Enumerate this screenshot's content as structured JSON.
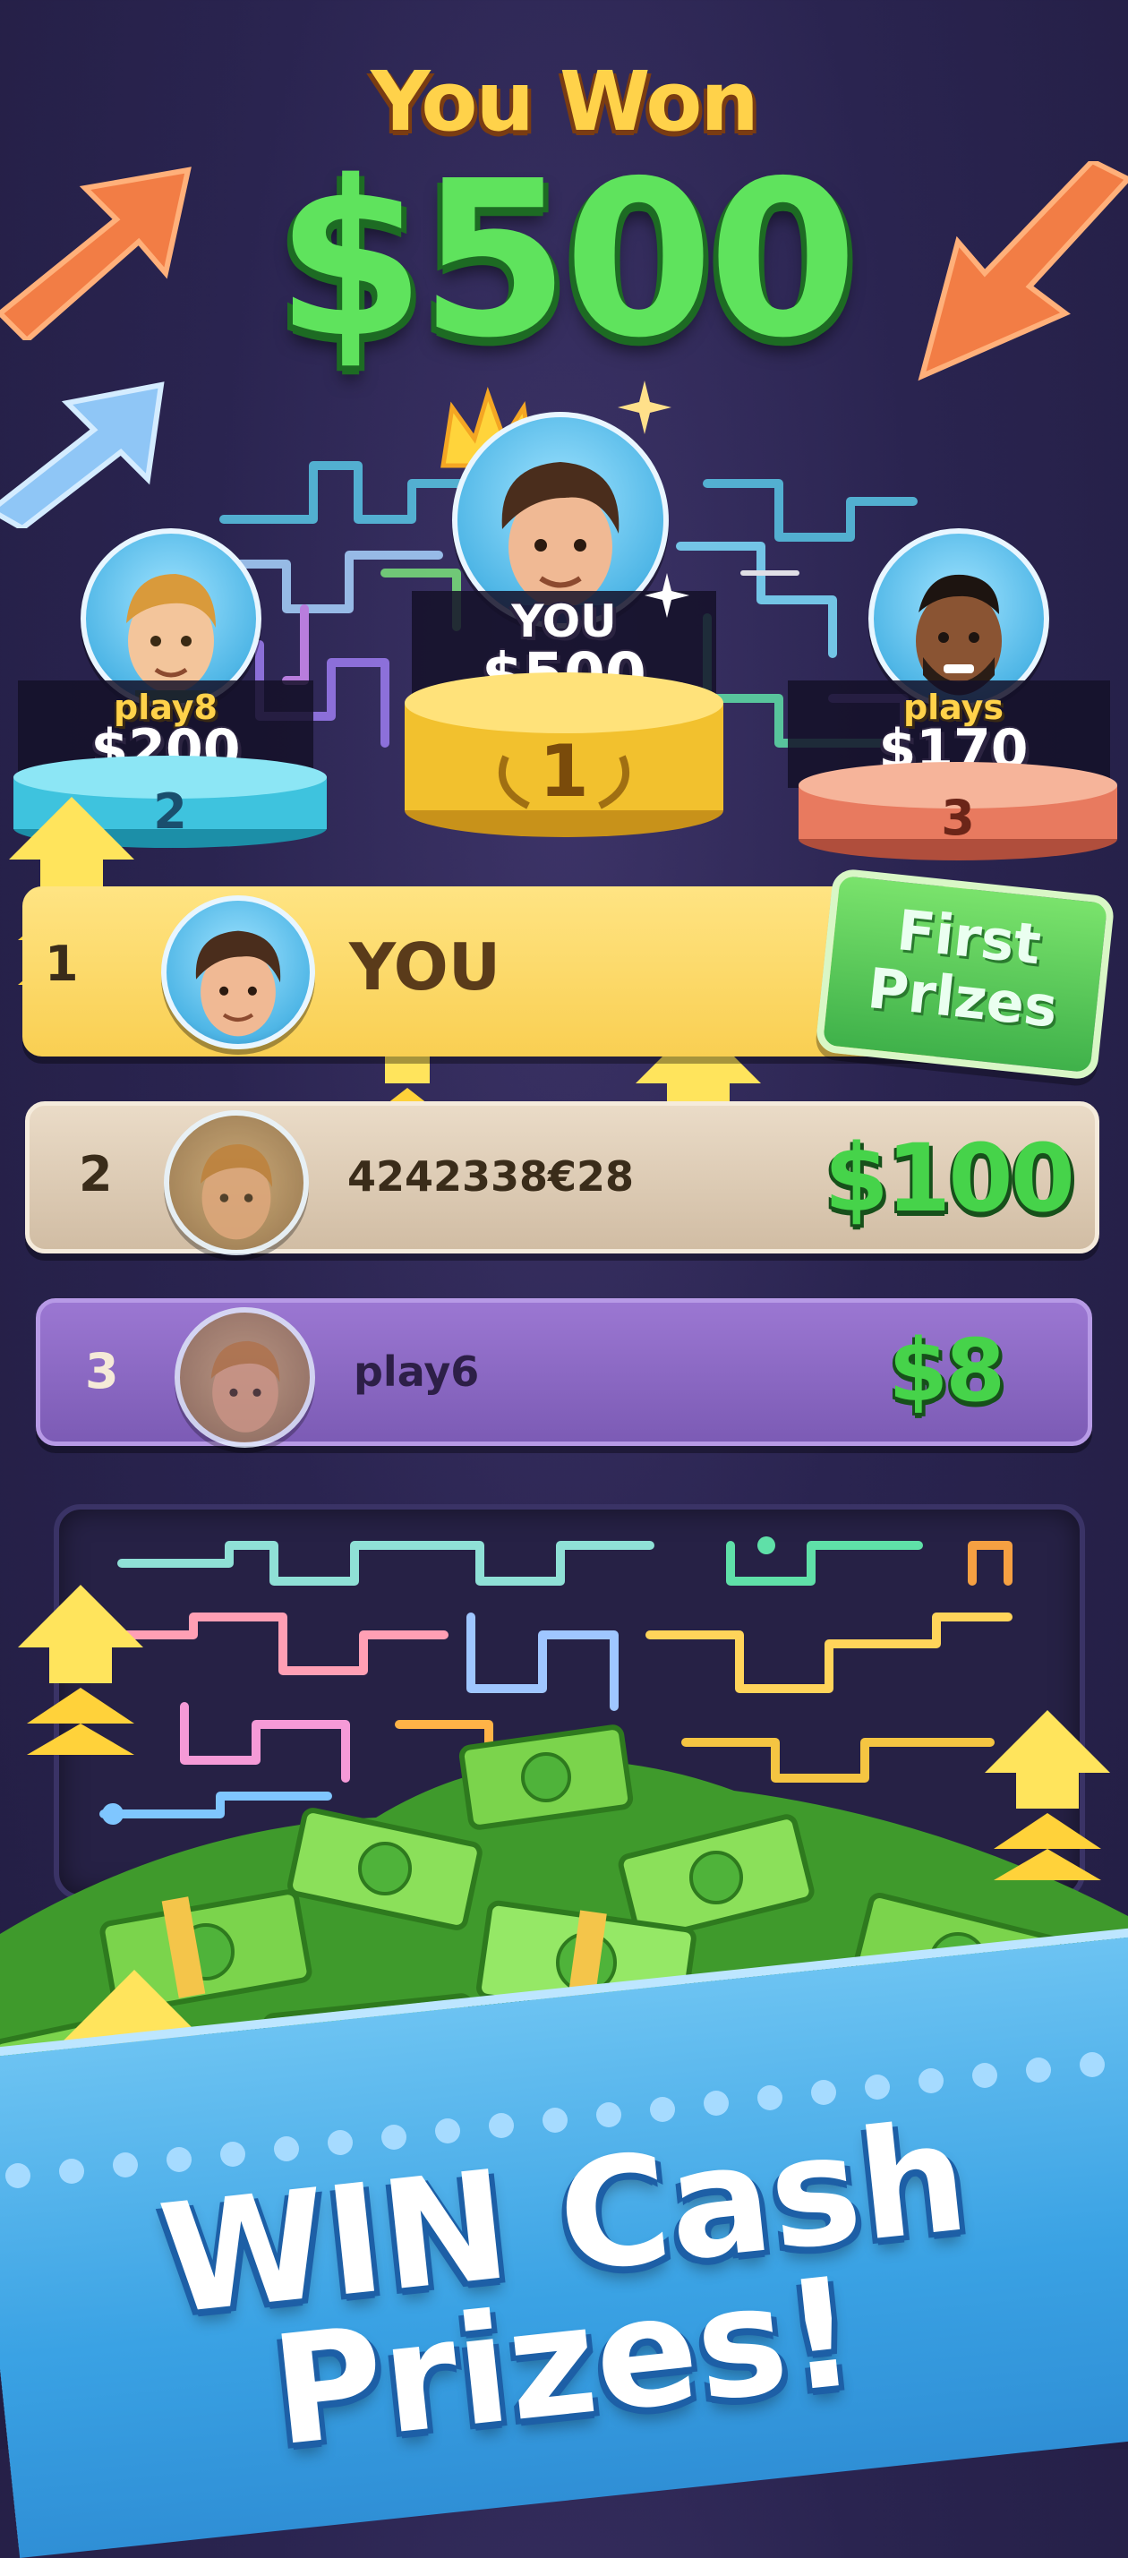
{
  "header": {
    "title_line1": "You Won",
    "title_amount": "$500"
  },
  "podium": {
    "first": {
      "name": "YOU",
      "amount": "$500",
      "place": "1"
    },
    "second": {
      "name": "play8",
      "amount": "$200",
      "place": "2"
    },
    "third": {
      "name": "plays",
      "amount": "$170",
      "place": "3"
    }
  },
  "leaderboard": [
    {
      "rank": "1",
      "name": "YOU",
      "badge_line1": "First",
      "badge_line2": "Prlzes"
    },
    {
      "rank": "2",
      "name": "4242338€28",
      "amount": "$100"
    },
    {
      "rank": "3",
      "name": "play6",
      "amount": "$8"
    }
  ],
  "cta": {
    "line1": "WIN Cash",
    "line2": "Prizes!"
  },
  "colors": {
    "gold": "#ffd24a",
    "green": "#5fe35d",
    "row1": "#fbd65e",
    "row2": "#d8c6b0",
    "row3": "#8b67c2",
    "banner": "#3aa2e4"
  },
  "icons": [
    "arrow-up-right-icon",
    "arrow-down-left-icon",
    "crown-icon",
    "sparkle-icon",
    "laurel-icon",
    "chevron-up-icon",
    "dollar-bill-icon"
  ]
}
